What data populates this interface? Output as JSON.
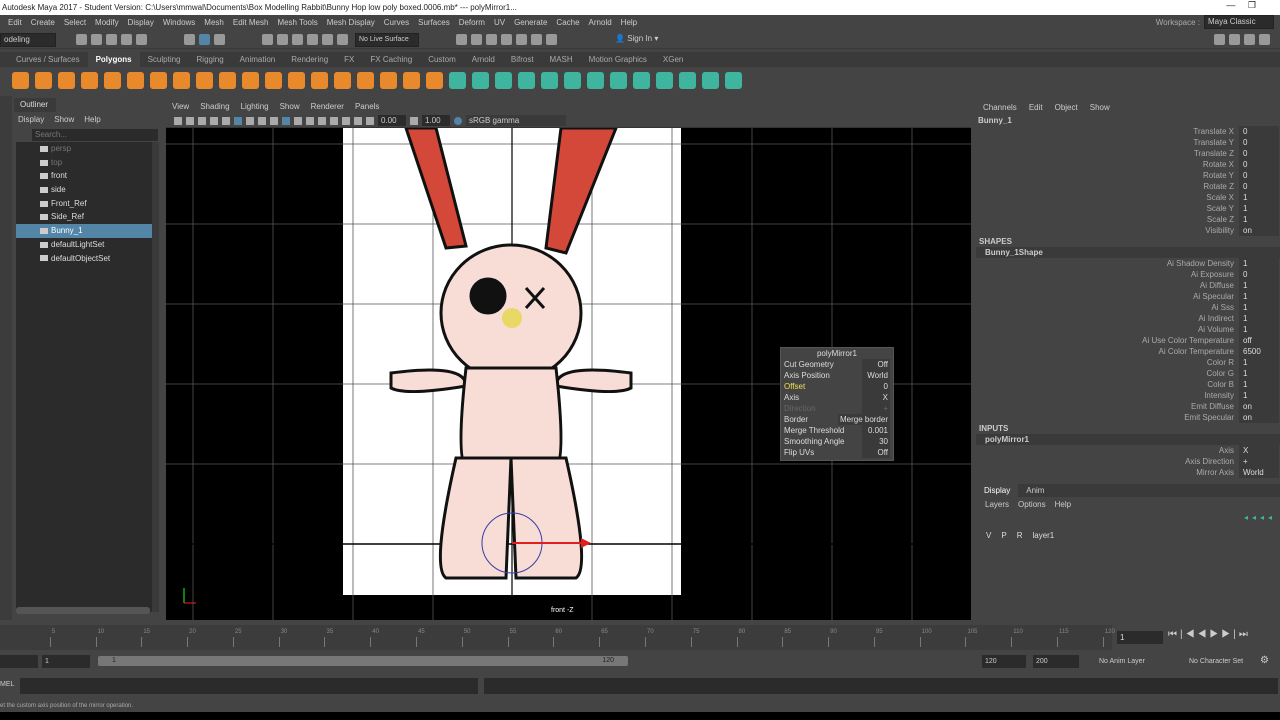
{
  "title": "Autodesk Maya 2017 - Student Version: C:\\Users\\mmwal\\Documents\\Box Modelling Rabbit\\Bunny Hop low poly boxed.0006.mb*  ---  polyMirror1...",
  "menu": [
    "Edit",
    "Create",
    "Select",
    "Modify",
    "Display",
    "Windows",
    "Mesh",
    "Edit Mesh",
    "Mesh Tools",
    "Mesh Display",
    "Curves",
    "Surfaces",
    "Deform",
    "UV",
    "Generate",
    "Cache",
    "Arnold",
    "Help"
  ],
  "workspace": {
    "label": "Workspace :",
    "value": "Maya Classic"
  },
  "status": {
    "mode": "odeling",
    "live_surface": "No Live Surface",
    "sign_in": "Sign In"
  },
  "shelf_tabs": [
    "Curves / Surfaces",
    "Polygons",
    "Sculpting",
    "Rigging",
    "Animation",
    "Rendering",
    "FX",
    "FX Caching",
    "Custom",
    "Arnold",
    "Bifrost",
    "MASH",
    "Motion Graphics",
    "XGen"
  ],
  "outliner": {
    "tab": "Outliner",
    "menu": [
      "Display",
      "Show",
      "Help"
    ],
    "search_placeholder": "Search...",
    "items": [
      {
        "label": "persp",
        "dim": true
      },
      {
        "label": "top",
        "dim": true
      },
      {
        "label": "front"
      },
      {
        "label": "side"
      },
      {
        "label": "Front_Ref"
      },
      {
        "label": "Side_Ref"
      },
      {
        "label": "Bunny_1",
        "selected": true
      },
      {
        "label": "defaultLightSet"
      },
      {
        "label": "defaultObjectSet"
      }
    ]
  },
  "viewport": {
    "menu": [
      "View",
      "Shading",
      "Lighting",
      "Show",
      "Renderer",
      "Panels"
    ],
    "exposure": "0.00",
    "gamma": "1.00",
    "colorspace": "sRGB gamma",
    "camera": "front -Z"
  },
  "popup": {
    "title": "polyMirror1",
    "rows": [
      {
        "k": "Cut Geometry",
        "v": "Off"
      },
      {
        "k": "Axis Position",
        "v": "World"
      },
      {
        "k": "Offset",
        "v": "0",
        "hl": true
      },
      {
        "k": "Axis",
        "v": "X"
      },
      {
        "k": "Direction",
        "v": "+",
        "dis": true
      },
      {
        "k": "Border",
        "v": "Merge border"
      },
      {
        "k": "Merge Threshold",
        "v": "0.001"
      },
      {
        "k": "Smoothing Angle",
        "v": "30"
      },
      {
        "k": "Flip UVs",
        "v": "Off"
      }
    ]
  },
  "channel": {
    "menu": [
      "Channels",
      "Edit",
      "Object",
      "Show"
    ],
    "object": "Bunny_1",
    "transform": [
      {
        "k": "Translate X",
        "v": "0"
      },
      {
        "k": "Translate Y",
        "v": "0"
      },
      {
        "k": "Translate Z",
        "v": "0"
      },
      {
        "k": "Rotate X",
        "v": "0"
      },
      {
        "k": "Rotate Y",
        "v": "0"
      },
      {
        "k": "Rotate Z",
        "v": "0"
      },
      {
        "k": "Scale X",
        "v": "1"
      },
      {
        "k": "Scale Y",
        "v": "1"
      },
      {
        "k": "Scale Z",
        "v": "1"
      },
      {
        "k": "Visibility",
        "v": "on"
      }
    ],
    "shapes_label": "SHAPES",
    "shape": "Bunny_1Shape",
    "shape_attrs": [
      {
        "k": "Ai Shadow Density",
        "v": "1"
      },
      {
        "k": "Ai Exposure",
        "v": "0"
      },
      {
        "k": "Ai Diffuse",
        "v": "1"
      },
      {
        "k": "Ai Specular",
        "v": "1"
      },
      {
        "k": "Ai Sss",
        "v": "1"
      },
      {
        "k": "Ai Indirect",
        "v": "1"
      },
      {
        "k": "Ai Volume",
        "v": "1"
      },
      {
        "k": "Ai Use Color Temperature",
        "v": "off"
      },
      {
        "k": "Ai Color Temperature",
        "v": "6500"
      },
      {
        "k": "Color R",
        "v": "1"
      },
      {
        "k": "Color G",
        "v": "1"
      },
      {
        "k": "Color B",
        "v": "1"
      },
      {
        "k": "Intensity",
        "v": "1"
      },
      {
        "k": "Emit Diffuse",
        "v": "on"
      },
      {
        "k": "Emit Specular",
        "v": "on"
      }
    ],
    "inputs_label": "INPUTS",
    "input": "polyMirror1",
    "input_attrs": [
      {
        "k": "Axis",
        "v": "X"
      },
      {
        "k": "Axis Direction",
        "v": "+"
      },
      {
        "k": "Mirror Axis",
        "v": "World"
      }
    ]
  },
  "layers": {
    "tabs": [
      "Display",
      "Anim"
    ],
    "menu": [
      "Layers",
      "Options",
      "Help"
    ],
    "row": {
      "v": "V",
      "p": "P",
      "r": "R",
      "name": "layer1"
    }
  },
  "timeline": {
    "ticks": [
      5,
      10,
      15,
      20,
      25,
      30,
      35,
      40,
      45,
      50,
      55,
      60,
      65,
      70,
      75,
      80,
      85,
      90,
      95,
      100,
      105,
      110,
      115,
      120
    ],
    "current": "1"
  },
  "range": {
    "start": "1",
    "inner_start": "1",
    "inner_end": "120",
    "end": "120",
    "max": "200",
    "anim_layer": "No Anim Layer",
    "char_set": "No Character Set"
  },
  "cmd": {
    "label": "MEL"
  },
  "help_line": "et the custom axis position of the mirror operation."
}
